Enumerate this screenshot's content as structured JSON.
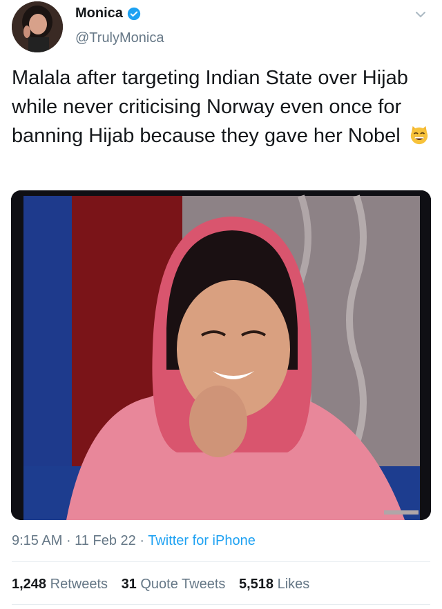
{
  "author": {
    "name": "Monica",
    "handle": "@TrulyMonica",
    "verified": true,
    "avatar_icon": "profile-photo"
  },
  "tweet": {
    "text": "Malala after targeting Indian State over Hijab while never criticising Norway even once for banning Hijab because they gave her Nobel",
    "emoji_icon": "grinning-cat-with-smiling-eyes-icon"
  },
  "meta": {
    "time": "9:15 AM",
    "separator": " · ",
    "date": "11 Feb 22",
    "source": "Twitter for iPhone"
  },
  "stats": {
    "retweets_count": "1,248",
    "retweets_label": "Retweets",
    "quote_count": "31",
    "quote_label": "Quote Tweets",
    "likes_count": "5,518",
    "likes_label": "Likes"
  },
  "colors": {
    "link": "#1da1f2",
    "secondary_text": "#657786",
    "primary_text": "#14171a"
  }
}
